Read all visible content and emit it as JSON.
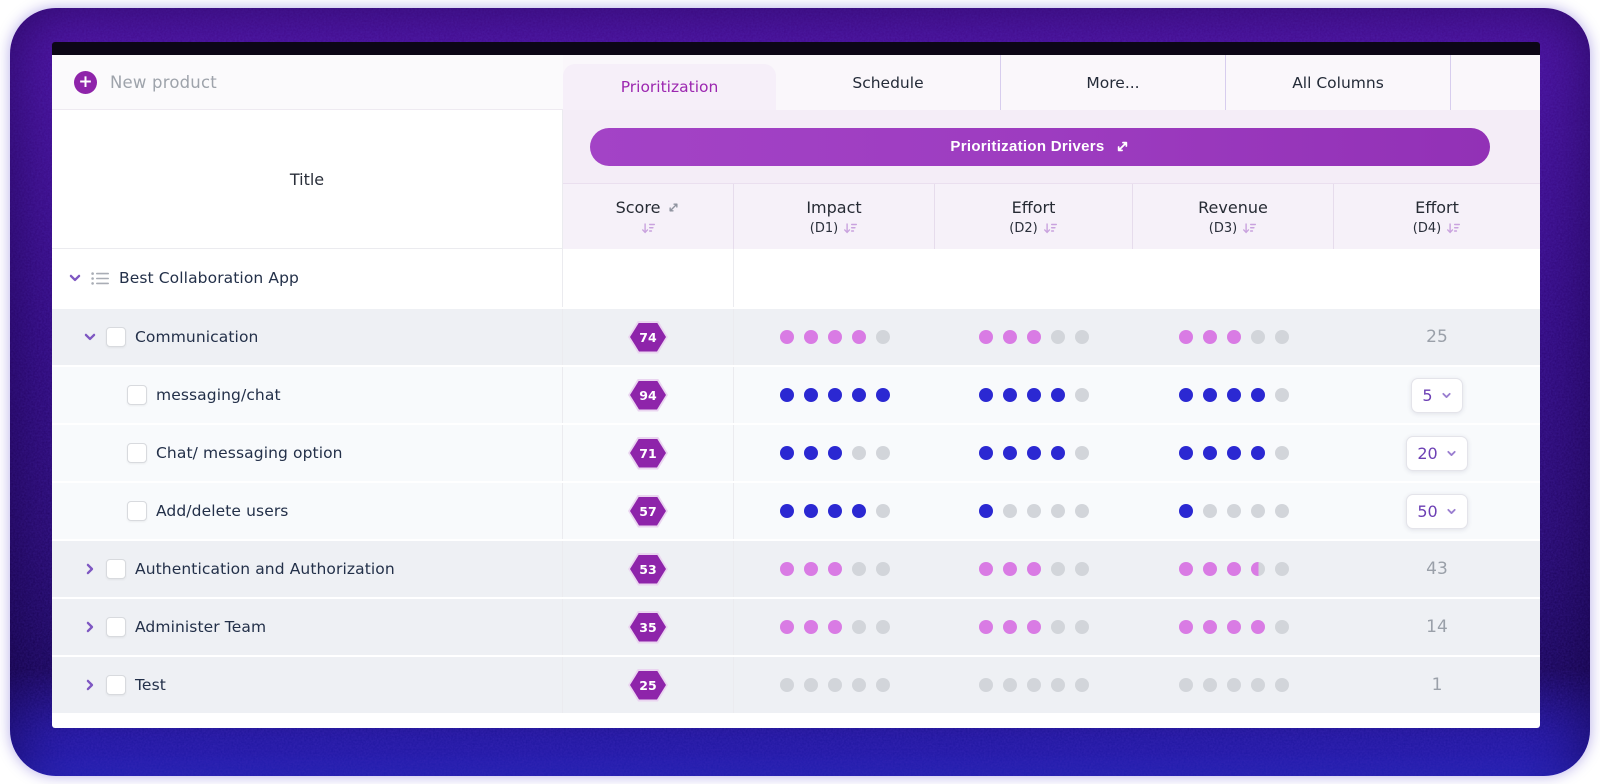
{
  "topbar": {
    "new_product_label": "New product"
  },
  "tabs": [
    {
      "label": "Prioritization",
      "active": true
    },
    {
      "label": "Schedule",
      "active": false
    },
    {
      "label": "More...",
      "active": false
    },
    {
      "label": "All Columns",
      "active": false
    }
  ],
  "banner": {
    "label": "Prioritization Drivers"
  },
  "table": {
    "title_header": "Title",
    "columns": [
      {
        "label": "Score",
        "sub": "",
        "has_expand_icon": true,
        "has_sort_icon": true
      },
      {
        "label": "Impact",
        "sub": "(D1)",
        "has_sort_icon": true
      },
      {
        "label": "Effort",
        "sub": "(D2)",
        "has_sort_icon": true
      },
      {
        "label": "Revenue",
        "sub": "(D3)",
        "has_sort_icon": true
      },
      {
        "label": "Effort",
        "sub": "(D4)",
        "has_sort_icon": true
      }
    ],
    "dots_per_rating": 5,
    "rows": [
      {
        "title": "Best Collaboration App",
        "level": 0,
        "chevron": "down",
        "icon": "list-icon",
        "checkbox": false,
        "bg": "white",
        "score": null
      },
      {
        "title": "Communication",
        "level": 1,
        "chevron": "down",
        "checkbox": true,
        "bg": "gray",
        "score": "74",
        "dot_color": "pink",
        "impact": {
          "filled": 4
        },
        "effort": {
          "filled": 3
        },
        "revenue": {
          "filled": 3
        },
        "effort_value": {
          "type": "text",
          "value": "25"
        }
      },
      {
        "title": "messaging/chat",
        "level": 2,
        "chevron": null,
        "checkbox": true,
        "bg": "light",
        "score": "94",
        "dot_color": "blue",
        "impact": {
          "filled": 5
        },
        "effort": {
          "filled": 4
        },
        "revenue": {
          "filled": 4
        },
        "effort_value": {
          "type": "dropdown",
          "value": "5"
        }
      },
      {
        "title": "Chat/ messaging option",
        "level": 2,
        "chevron": null,
        "checkbox": true,
        "bg": "light",
        "score": "71",
        "dot_color": "blue",
        "impact": {
          "filled": 3
        },
        "effort": {
          "filled": 4
        },
        "revenue": {
          "filled": 4
        },
        "effort_value": {
          "type": "dropdown",
          "value": "20"
        }
      },
      {
        "title": "Add/delete users",
        "level": 2,
        "chevron": null,
        "checkbox": true,
        "bg": "light",
        "score": "57",
        "dot_color": "blue",
        "impact": {
          "filled": 4
        },
        "effort": {
          "filled": 1
        },
        "revenue": {
          "filled": 1
        },
        "effort_value": {
          "type": "dropdown",
          "value": "50"
        }
      },
      {
        "title": "Authentication and Authorization",
        "level": 1,
        "chevron": "right",
        "checkbox": true,
        "bg": "gray",
        "score": "53",
        "dot_color": "pink",
        "impact": {
          "filled": 3
        },
        "effort": {
          "filled": 3
        },
        "revenue": {
          "filled": 3,
          "half": true
        },
        "effort_value": {
          "type": "text",
          "value": "43"
        }
      },
      {
        "title": "Administer Team",
        "level": 1,
        "chevron": "right",
        "checkbox": true,
        "bg": "gray",
        "score": "35",
        "dot_color": "pink",
        "impact": {
          "filled": 3
        },
        "effort": {
          "filled": 3
        },
        "revenue": {
          "filled": 4
        },
        "effort_value": {
          "type": "text",
          "value": "14"
        }
      },
      {
        "title": "Test",
        "level": 1,
        "chevron": "right",
        "checkbox": true,
        "bg": "gray",
        "score": "25",
        "dot_color": "gray",
        "impact": {
          "filled": 0
        },
        "effort": {
          "filled": 0
        },
        "revenue": {
          "filled": 0
        },
        "effort_value": {
          "type": "text",
          "value": "1"
        }
      }
    ]
  },
  "icons": {
    "plus-icon": "+",
    "expand-icon": "double diagonal arrow NE/SW",
    "sort-desc-icon": "down arrow with shrinking bars",
    "chevron-down-icon": "v",
    "chevron-right-icon": ">",
    "list-icon": "three lines with bullets",
    "dropdown-chevron-icon": "v"
  },
  "colors": {
    "accent": "#9c27b0",
    "badge": "#8e24aa",
    "banner": "#9d3cc0",
    "dot_pink": "#d97be4",
    "dot_blue": "#2b28d2",
    "dot_gray": "#d2d5da",
    "row_gray": "#eef0f4",
    "row_light": "#f8fafc",
    "value_gray": "#9aa0a9"
  }
}
